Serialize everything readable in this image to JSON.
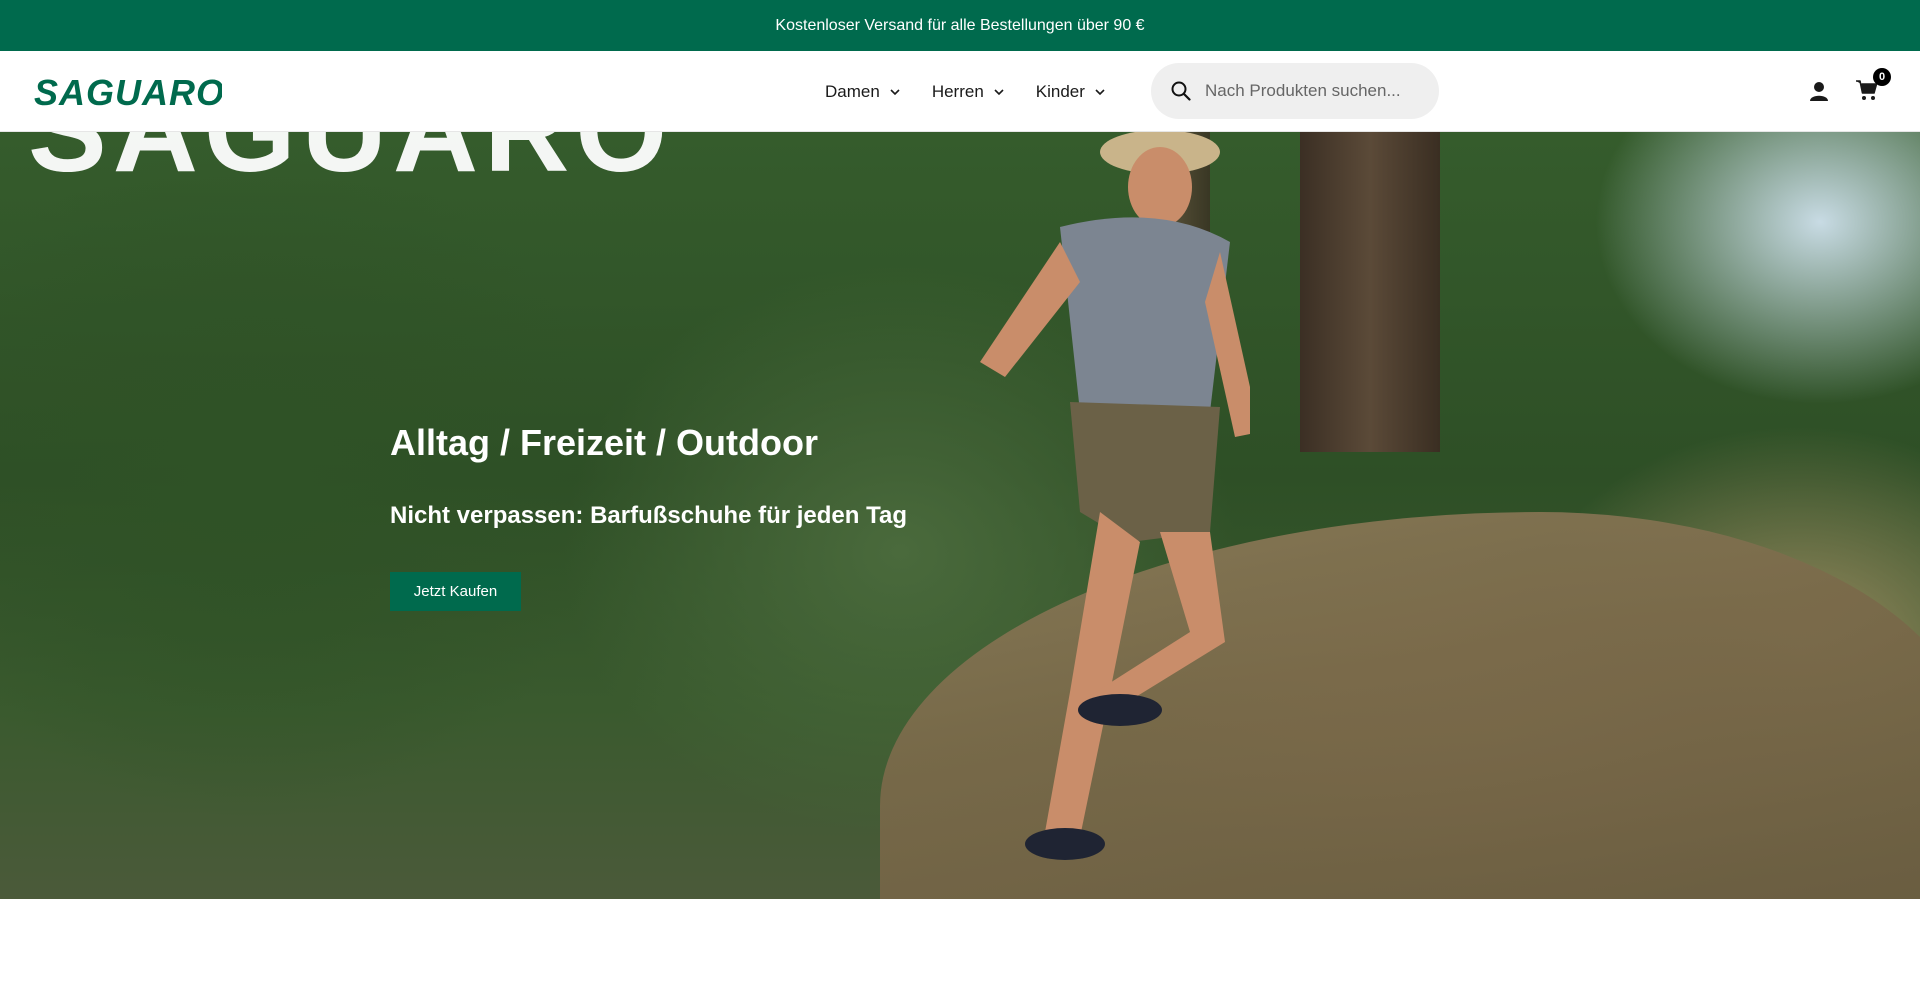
{
  "announcement": {
    "text": "Kostenloser Versand für alle Bestellungen über 90 €"
  },
  "header": {
    "logo_text": "SAGUARO",
    "nav": [
      {
        "label": "Damen"
      },
      {
        "label": "Herren"
      },
      {
        "label": "Kinder"
      }
    ],
    "search": {
      "placeholder": "Nach Produkten suchen...",
      "value": ""
    },
    "cart_count": "0"
  },
  "hero": {
    "background_word": "SAGUARO",
    "title": "Alltag / Freizeit / Outdoor",
    "subtitle": "Nicht verpassen: Barfußschuhe für jeden Tag",
    "cta_label": "Jetzt Kaufen"
  },
  "colors": {
    "brand_green": "#006a4d",
    "header_bg": "#ffffff",
    "search_bg": "#efefef"
  },
  "icons": [
    "chevron-down-icon",
    "search-icon",
    "user-icon",
    "cart-icon"
  ]
}
